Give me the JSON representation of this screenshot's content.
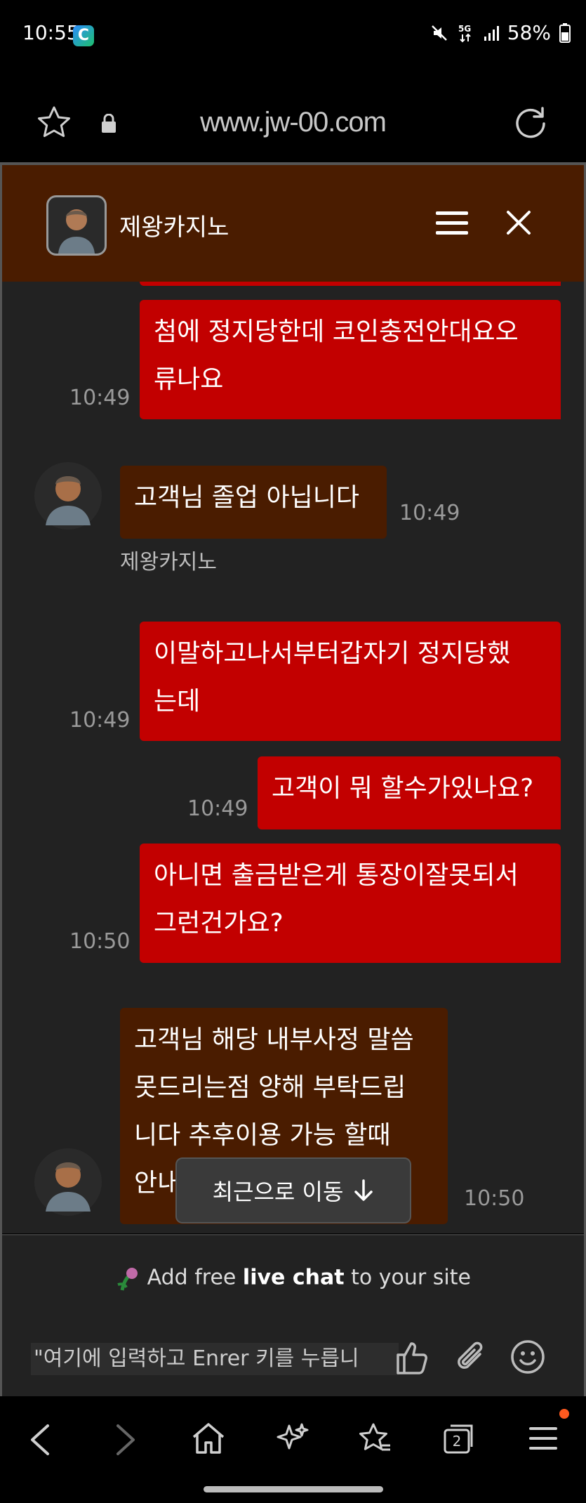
{
  "status_bar": {
    "time": "10:55",
    "battery": "58%"
  },
  "browser": {
    "url": "www.jw-00.com",
    "tab_count": "2"
  },
  "chat": {
    "title": "제왕카지노",
    "messages": [
      {
        "side": "user",
        "lines": [
          "첨에 정지당한데 코인충전안대요오",
          "류나요"
        ],
        "time": "10:49"
      },
      {
        "side": "agent",
        "lines": [
          "고객님 졸업 아닙니다"
        ],
        "time": "10:49",
        "sender": "제왕카지노"
      },
      {
        "side": "user",
        "lines": [
          "이말하고나서부터갑자기 정지당했",
          "는데"
        ],
        "time": "10:49"
      },
      {
        "side": "user",
        "lines": [
          "고객이 뭐 할수가있나요?"
        ],
        "time": "10:49"
      },
      {
        "side": "user",
        "lines": [
          "아니면 출금받은게 통장이잘못되서",
          "그런건가요?"
        ],
        "time": "10:50"
      },
      {
        "side": "agent",
        "lines": [
          "고객님 해당 내부사정 말씀",
          "못드리는점 양해 부탁드립",
          "니다 추후이용 가능 할때",
          "안내"
        ],
        "time": "10:50"
      }
    ],
    "jump_label": "최근으로 이동",
    "promo": {
      "prefix": "Add free",
      "bold": "live chat",
      "suffix": "to your site"
    },
    "input_placeholder": "\"여기에 입력하고 Enrer 키를 누릅니"
  },
  "colors": {
    "header_bg": "#4a1c00",
    "user_bubble": "#c20000",
    "agent_bubble": "#4a1c00",
    "chat_bg": "#222222"
  }
}
